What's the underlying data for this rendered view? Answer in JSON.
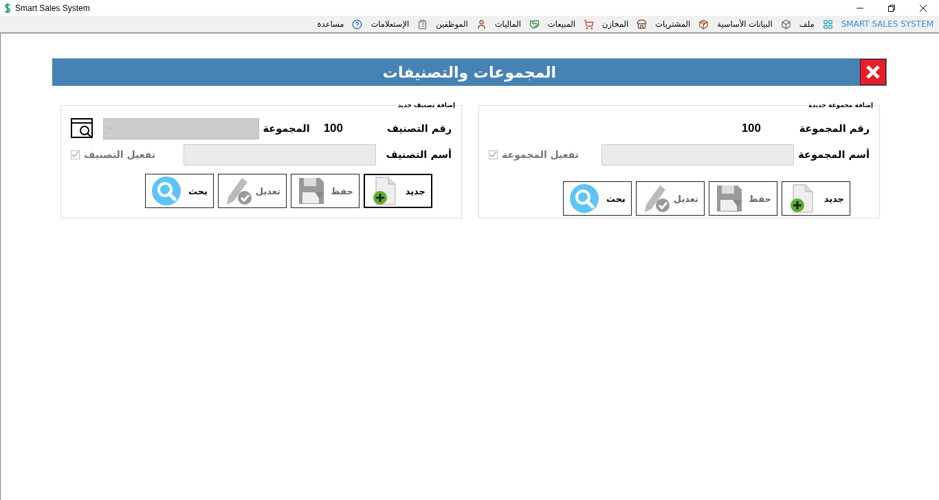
{
  "window": {
    "title": "Smart Sales System"
  },
  "menu": [
    {
      "label": "SMART SALES SYSTEM",
      "kind": "brand"
    },
    {
      "label": "ملف",
      "kind": "item"
    },
    {
      "label": "البيانات الأساسية",
      "kind": "item"
    },
    {
      "label": "المشتريات",
      "kind": "item"
    },
    {
      "label": "المخازن",
      "kind": "item"
    },
    {
      "label": "المبيعات",
      "kind": "item"
    },
    {
      "label": "الماليات",
      "kind": "item"
    },
    {
      "label": "الموظفين",
      "kind": "item"
    },
    {
      "label": "الإستعلامات",
      "kind": "item"
    },
    {
      "label": "مساعدة",
      "kind": "item"
    }
  ],
  "form": {
    "title": "المجموعات والتصنيفات"
  },
  "panels": [
    {
      "kind": "group",
      "legend": "إضافة مجموعة جديدة",
      "number_label": "رقم المجموعة",
      "number": "100",
      "name_label": "أسم المجموعة",
      "name_field": {
        "disabled": true
      },
      "active": {
        "label": "تفعيل المجموعة",
        "checked": true,
        "disabled": true
      },
      "buttons": [
        {
          "label": "جديد",
          "kind": "new",
          "focused": false,
          "disabled": false
        },
        {
          "label": "حفظ",
          "kind": "save",
          "focused": false,
          "disabled": true
        },
        {
          "label": "تعديل",
          "kind": "edit",
          "focused": false,
          "disabled": true
        },
        {
          "label": "بحث",
          "kind": "search",
          "focused": false,
          "disabled": false
        }
      ]
    },
    {
      "kind": "category",
      "legend": "إضافة تصنيف جديد",
      "number_label": "رقم التصنيف",
      "number": "100",
      "group_label": "المجموعة",
      "group_field": {
        "disabled": true
      },
      "name_label": "أسم التصنيف",
      "name_field": {
        "disabled": true
      },
      "active": {
        "label": "تفعيل التصنيف",
        "checked": true,
        "disabled": true
      },
      "buttons": [
        {
          "label": "جديد",
          "kind": "new",
          "focused": true,
          "disabled": false
        },
        {
          "label": "حفظ",
          "kind": "save",
          "focused": false,
          "disabled": true
        },
        {
          "label": "تعديل",
          "kind": "edit",
          "focused": false,
          "disabled": true
        },
        {
          "label": "بحث",
          "kind": "search",
          "focused": false,
          "disabled": false
        }
      ]
    }
  ]
}
